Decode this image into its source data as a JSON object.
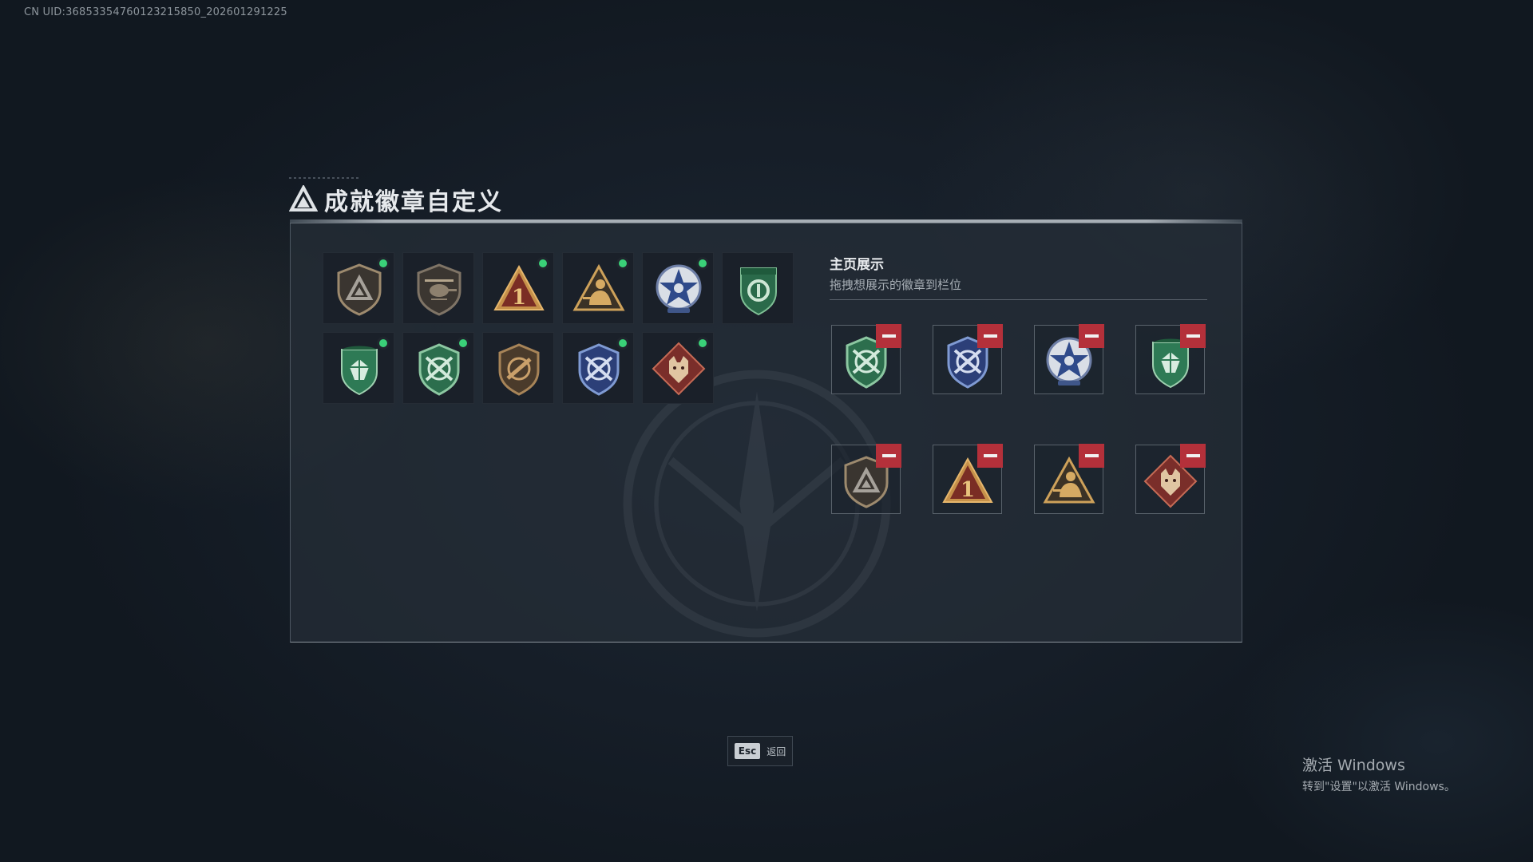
{
  "uid_text": "CN UID:36853354760123215850_202601291225",
  "title": "成就徽章自定义",
  "badges": [
    {
      "icon": "triangle-shield-badge-icon",
      "new": true
    },
    {
      "icon": "helicopter-badge-icon",
      "new": false
    },
    {
      "icon": "number-one-badge-icon",
      "new": true
    },
    {
      "icon": "soldier-triangle-badge-icon",
      "new": true
    },
    {
      "icon": "blue-star-badge-icon",
      "new": true
    },
    {
      "icon": "green-gear-badge-icon",
      "new": false
    },
    {
      "icon": "green-gem-badge-icon",
      "new": true
    },
    {
      "icon": "green-rifles-badge-icon",
      "new": true
    },
    {
      "icon": "bronze-rifle-badge-icon",
      "new": false
    },
    {
      "icon": "blue-rifles-badge-icon",
      "new": true
    },
    {
      "icon": "wolf-diamond-badge-icon",
      "new": true
    }
  ],
  "display": {
    "title": "主页展示",
    "subtitle": "拖拽想展示的徽章到栏位",
    "slots": [
      "green-rifles-badge-icon",
      "blue-rifles-badge-icon",
      "blue-star-badge-icon",
      "green-gem-badge-icon",
      "triangle-shield-badge-icon",
      "number-one-badge-icon",
      "soldier-triangle-badge-icon",
      "wolf-diamond-badge-icon"
    ]
  },
  "footer": {
    "esc_key": "Esc",
    "esc_label": "返回"
  },
  "windows_notice": {
    "line1": "激活 Windows",
    "line2": "转到\"设置\"以激活 Windows。"
  },
  "colors": {
    "new_dot": "#3ad178",
    "remove": "#b4303a"
  }
}
